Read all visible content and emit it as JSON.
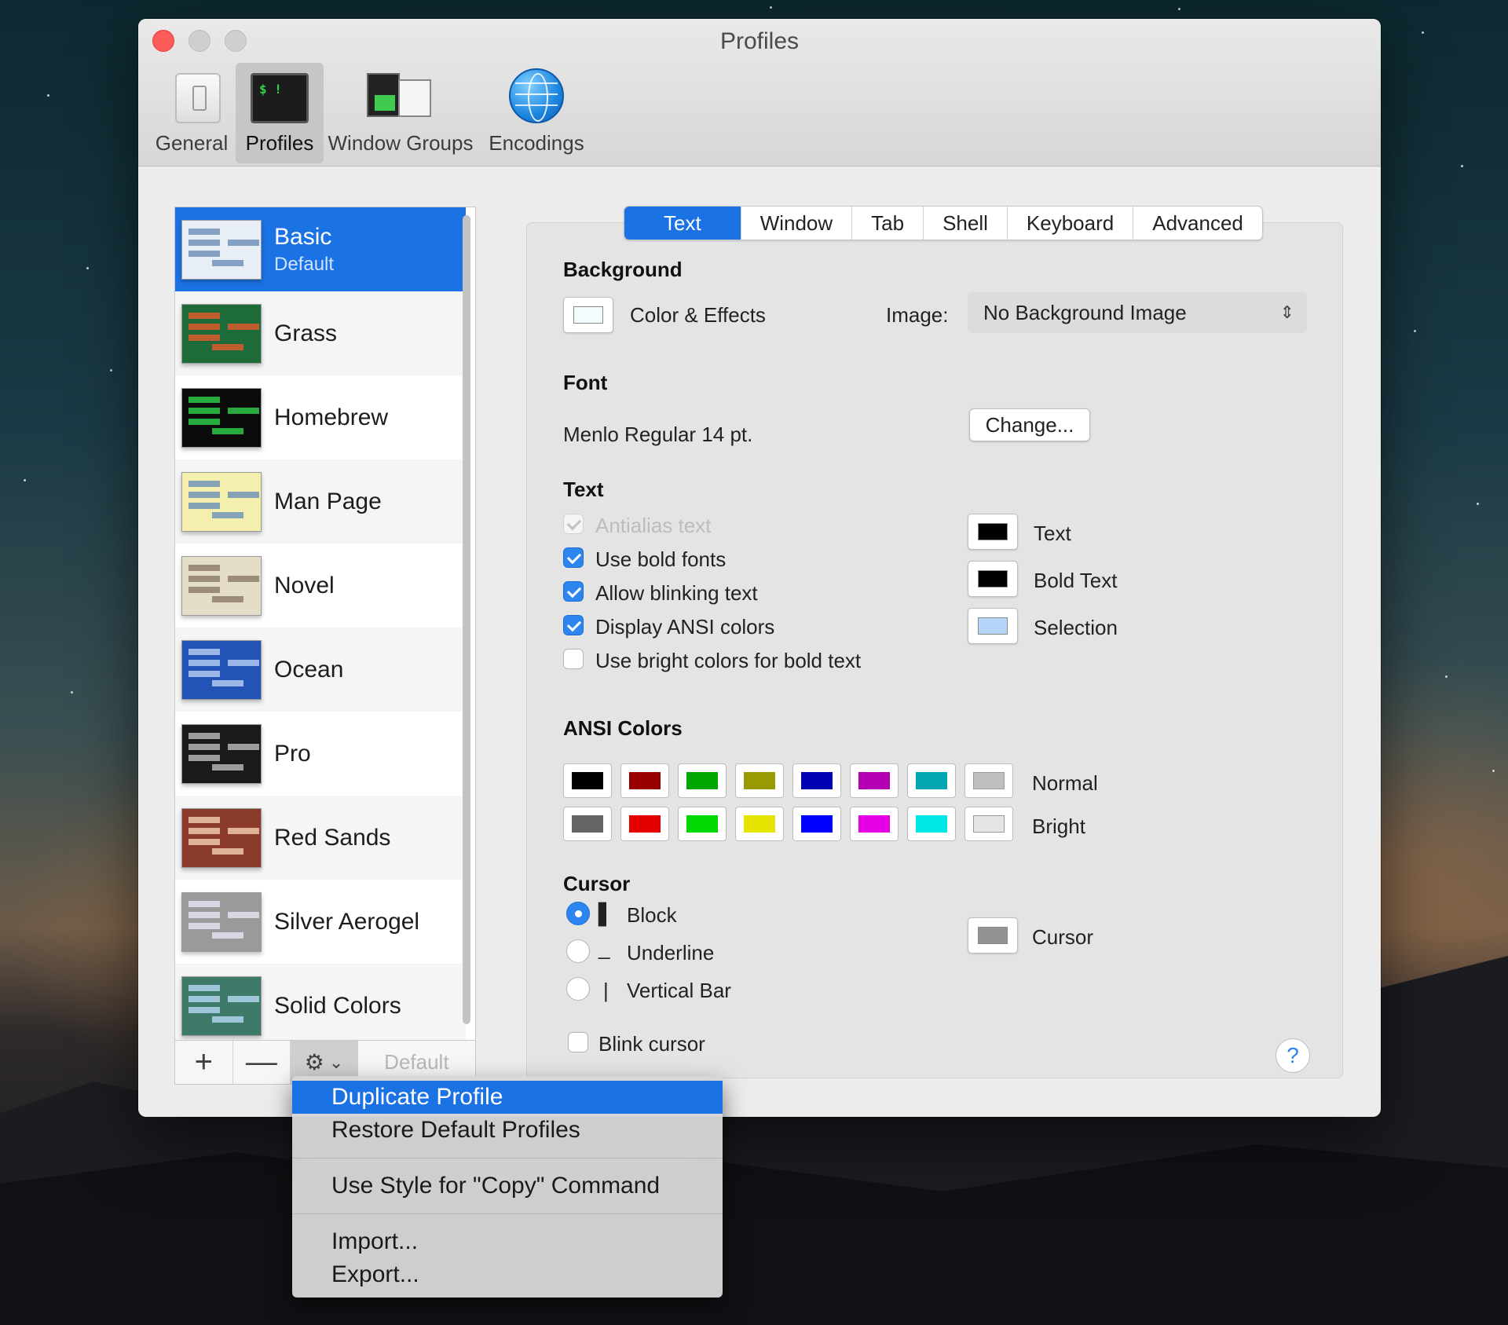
{
  "window": {
    "title": "Profiles"
  },
  "toolbar": {
    "items": [
      {
        "label": "General",
        "icon": "general-switch-icon"
      },
      {
        "label": "Profiles",
        "icon": "terminal-icon",
        "active": true
      },
      {
        "label": "Window Groups",
        "icon": "window-groups-icon"
      },
      {
        "label": "Encodings",
        "icon": "globe-icon"
      }
    ]
  },
  "profiles": {
    "items": [
      {
        "name": "Basic",
        "sub": "Default",
        "selected": true,
        "thumb_bg": "#e8eef5",
        "thumb_fg": "#6c8fb8"
      },
      {
        "name": "Grass",
        "thumb_bg": "#1e6b3a",
        "thumb_fg": "#e65a2b"
      },
      {
        "name": "Homebrew",
        "thumb_bg": "#0b0b0b",
        "thumb_fg": "#2fd24a"
      },
      {
        "name": "Man Page",
        "thumb_bg": "#f5efae",
        "thumb_fg": "#6b8fb8"
      },
      {
        "name": "Novel",
        "thumb_bg": "#e4ddc8",
        "thumb_fg": "#8a7a66"
      },
      {
        "name": "Ocean",
        "thumb_bg": "#2453b8",
        "thumb_fg": "#b8d0f5"
      },
      {
        "name": "Pro",
        "thumb_bg": "#1a1a1a",
        "thumb_fg": "#bdbdbd"
      },
      {
        "name": "Red Sands",
        "thumb_bg": "#8a3a2a",
        "thumb_fg": "#f2d0b0"
      },
      {
        "name": "Silver Aerogel",
        "thumb_bg": "#9a9a9a",
        "thumb_fg": "#e8e8f8"
      },
      {
        "name": "Solid Colors",
        "thumb_bg": "#3d7a6a",
        "thumb_fg": "#b8d8f5"
      }
    ],
    "controls": {
      "add": "+",
      "remove": "—",
      "gear": "⚙",
      "chevron": "⌄",
      "default": "Default"
    }
  },
  "tabs": [
    "Text",
    "Window",
    "Tab",
    "Shell",
    "Keyboard",
    "Advanced"
  ],
  "background": {
    "header": "Background",
    "effects_label": "Color & Effects",
    "image_label": "Image:",
    "image_value": "No Background Image"
  },
  "font": {
    "header": "Font",
    "value": "Menlo Regular 14 pt.",
    "change_button": "Change..."
  },
  "text": {
    "header": "Text",
    "options": [
      {
        "label": "Antialias text",
        "checked": true,
        "disabled": true
      },
      {
        "label": "Use bold fonts",
        "checked": true
      },
      {
        "label": "Allow blinking text",
        "checked": true
      },
      {
        "label": "Display ANSI colors",
        "checked": true
      },
      {
        "label": "Use bright colors for bold text",
        "checked": false
      }
    ],
    "colors": [
      {
        "label": "Text",
        "color": "#000000"
      },
      {
        "label": "Bold Text",
        "color": "#000000"
      },
      {
        "label": "Selection",
        "color": "#b5d5f8"
      }
    ]
  },
  "ansi": {
    "header": "ANSI Colors",
    "normal_label": "Normal",
    "bright_label": "Bright",
    "normal": [
      "#000000",
      "#990000",
      "#00a600",
      "#999900",
      "#0000b2",
      "#b200b2",
      "#00a6b2",
      "#bfbfbf"
    ],
    "bright": [
      "#666666",
      "#e50000",
      "#00d900",
      "#e5e500",
      "#0000ff",
      "#e500e5",
      "#00e5e5",
      "#e5e5e5"
    ]
  },
  "cursor": {
    "header": "Cursor",
    "options": [
      {
        "glyph": "▌",
        "label": "Block",
        "selected": true
      },
      {
        "glyph": "_",
        "label": "Underline",
        "selected": false
      },
      {
        "glyph": "|",
        "label": "Vertical Bar",
        "selected": false
      }
    ],
    "blink_label": "Blink cursor",
    "blink": false,
    "color_label": "Cursor",
    "color": "#929292"
  },
  "help": "?",
  "menu": {
    "items": [
      "Duplicate Profile",
      "Restore Default Profiles",
      "Use Style for \"Copy\" Command",
      "Import...",
      "Export..."
    ]
  }
}
